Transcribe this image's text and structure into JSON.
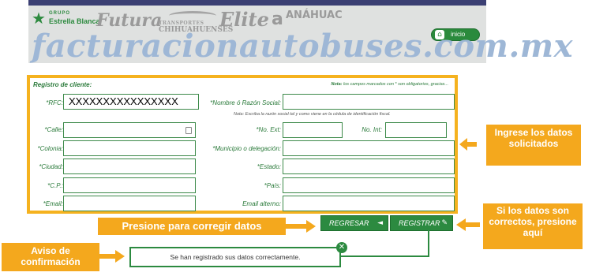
{
  "header": {
    "logo_group": "GRUPO",
    "logo_brand": "Estrella Blanca",
    "brands": [
      "Futura",
      "TRANSPORTES",
      "CHIHUAHUENSES",
      "Elite",
      "a",
      "ANÁHUAC"
    ],
    "home_button_label": "inicio",
    "home_icon": "home-icon"
  },
  "watermark": "facturacionautobuses.com.mx",
  "form": {
    "title": "Registro de cliente:",
    "note_label": "Nota:",
    "note_text": "los campos marcados con * son obligatorios, gracias...",
    "fields": {
      "rfc": {
        "label": "*RFC:",
        "value": "XXXXXXXXXXXXXXXX"
      },
      "razon_social": {
        "label": "*Nombre ó Razón Social:",
        "value": "",
        "note": "Nota: Escriba la razón  social tal y como viene en la cédula de identificación fiscal."
      },
      "calle": {
        "label": "*Calle:",
        "value": ""
      },
      "no_ext": {
        "label": "*No. Ext:",
        "value": ""
      },
      "no_int": {
        "label": "No. Int:",
        "value": ""
      },
      "colonia": {
        "label": "*Colonia:",
        "value": ""
      },
      "municipio": {
        "label": "*Municipio o delegación:",
        "value": ""
      },
      "ciudad": {
        "label": "*Ciudad:",
        "value": ""
      },
      "estado": {
        "label": "*Estado:",
        "value": ""
      },
      "cp": {
        "label": "*C.P.:",
        "value": ""
      },
      "pais": {
        "label": "*País:",
        "value": ""
      },
      "email": {
        "label": "*Email:",
        "value": ""
      },
      "email_alterno": {
        "label": "Email alterno:",
        "value": ""
      }
    }
  },
  "buttons": {
    "regresar": "REGRESAR",
    "regresar_glyph": "◄",
    "registrar": "REGISTRAR",
    "registrar_glyph": "✎"
  },
  "confirmation": {
    "message": "Se han registrado sus datos correctamente.",
    "close_glyph": "✕"
  },
  "callouts": {
    "ingrese": "Ingrese los datos solicitados",
    "presione": "Presione para corregir datos",
    "si_los_datos": "Si los datos son correctos, presione aquí",
    "aviso": "Aviso de confirmación"
  },
  "colors": {
    "accent_orange": "#f4a81d",
    "brand_green": "#2c8a40",
    "watermark_blue": "#9eb7d6"
  }
}
